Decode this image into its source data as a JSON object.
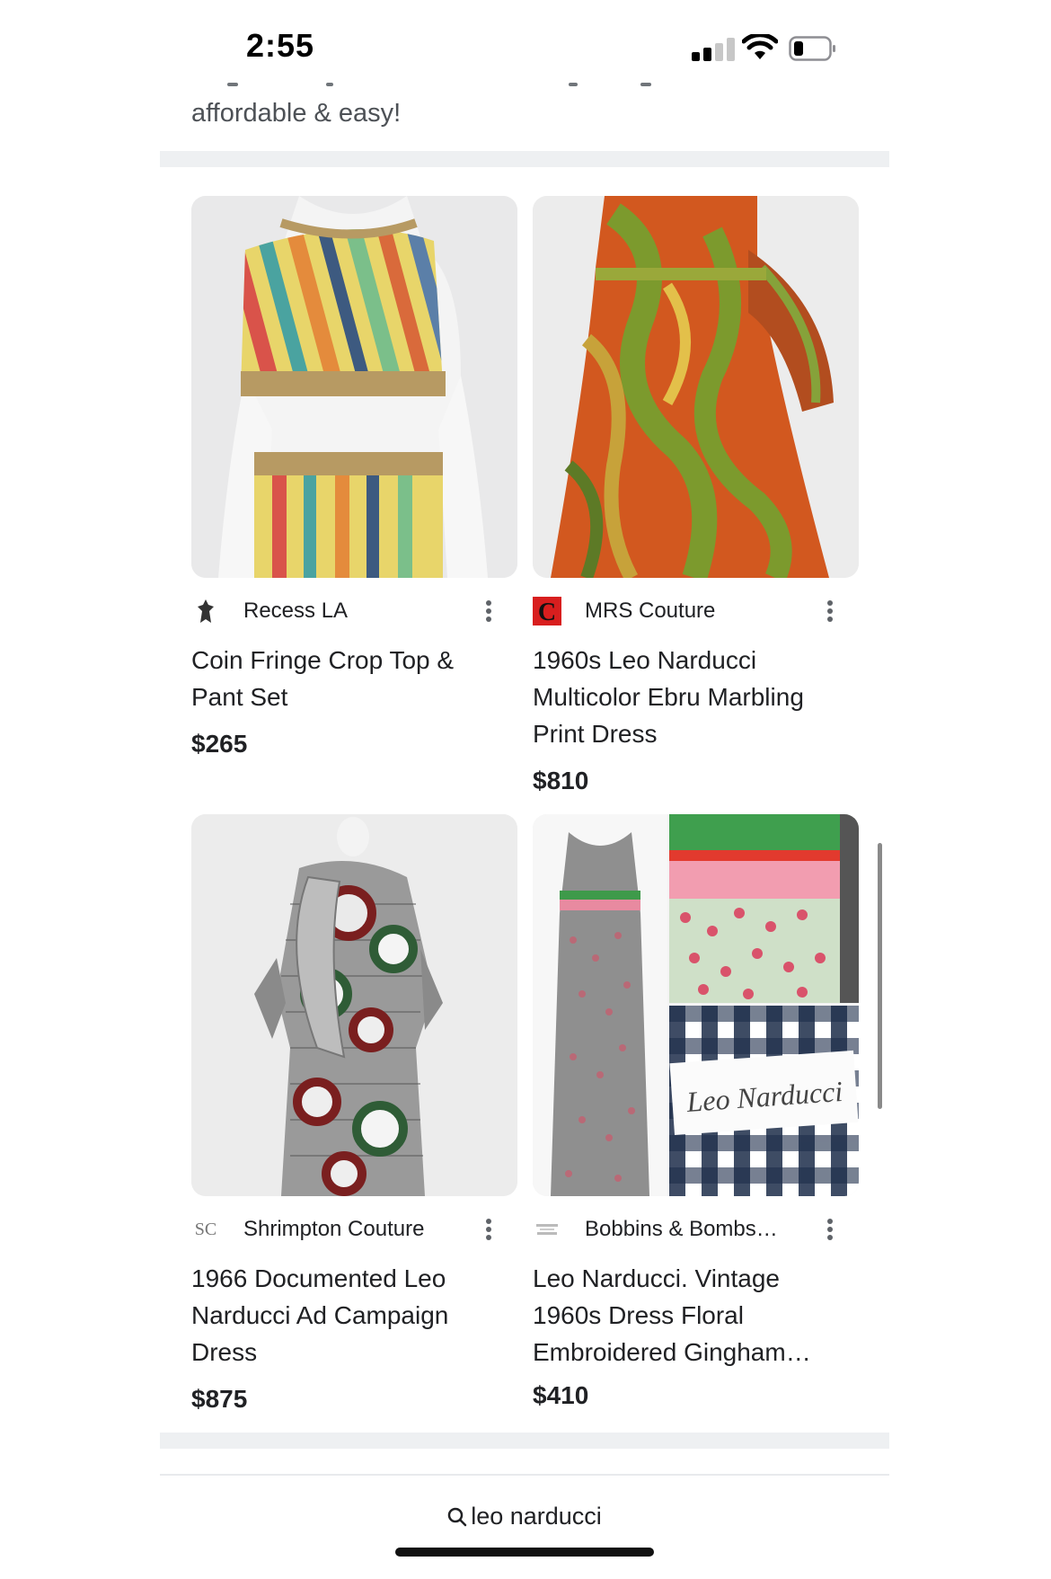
{
  "status_bar": {
    "time": "2:55"
  },
  "intro": {
    "text": "affordable & easy!"
  },
  "products": [
    {
      "merchant": "Recess LA",
      "title": "Coin Fringe Crop Top & Pant Set",
      "price": "$265"
    },
    {
      "merchant": "MRS Couture",
      "title": "1960s Leo Narducci Multicolor Ebru Marbling Print Dress",
      "price": "$810"
    },
    {
      "merchant": "Shrimpton Couture",
      "merchant_logo_text": "SC",
      "title": "1966 Documented Leo Narducci Ad Campaign Dress",
      "price": "$875"
    },
    {
      "merchant": "Bobbins & Bombs…",
      "title": "Leo Narducci. Vintage 1960s Dress Floral Embroidered Gingham…",
      "price": "$410",
      "image_label_text": "Leo Narducci"
    }
  ],
  "search": {
    "query": "leo narducci"
  },
  "icons": {
    "more": "more-vert-icon",
    "search": "search-icon",
    "signal": "cellular-signal-icon",
    "wifi": "wifi-icon",
    "battery": "battery-icon"
  }
}
